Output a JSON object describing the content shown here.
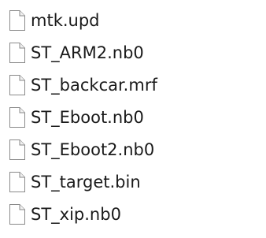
{
  "file_list": {
    "items": [
      {
        "name": "mtk.upd",
        "icon": "generic-file-icon"
      },
      {
        "name": "ST_ARM2.nb0",
        "icon": "generic-file-icon"
      },
      {
        "name": "ST_backcar.mrf",
        "icon": "generic-file-icon"
      },
      {
        "name": "ST_Eboot.nb0",
        "icon": "generic-file-icon"
      },
      {
        "name": "ST_Eboot2.nb0",
        "icon": "generic-file-icon"
      },
      {
        "name": "ST_target.bin",
        "icon": "generic-file-icon"
      },
      {
        "name": "ST_xip.nb0",
        "icon": "generic-file-icon"
      }
    ]
  }
}
